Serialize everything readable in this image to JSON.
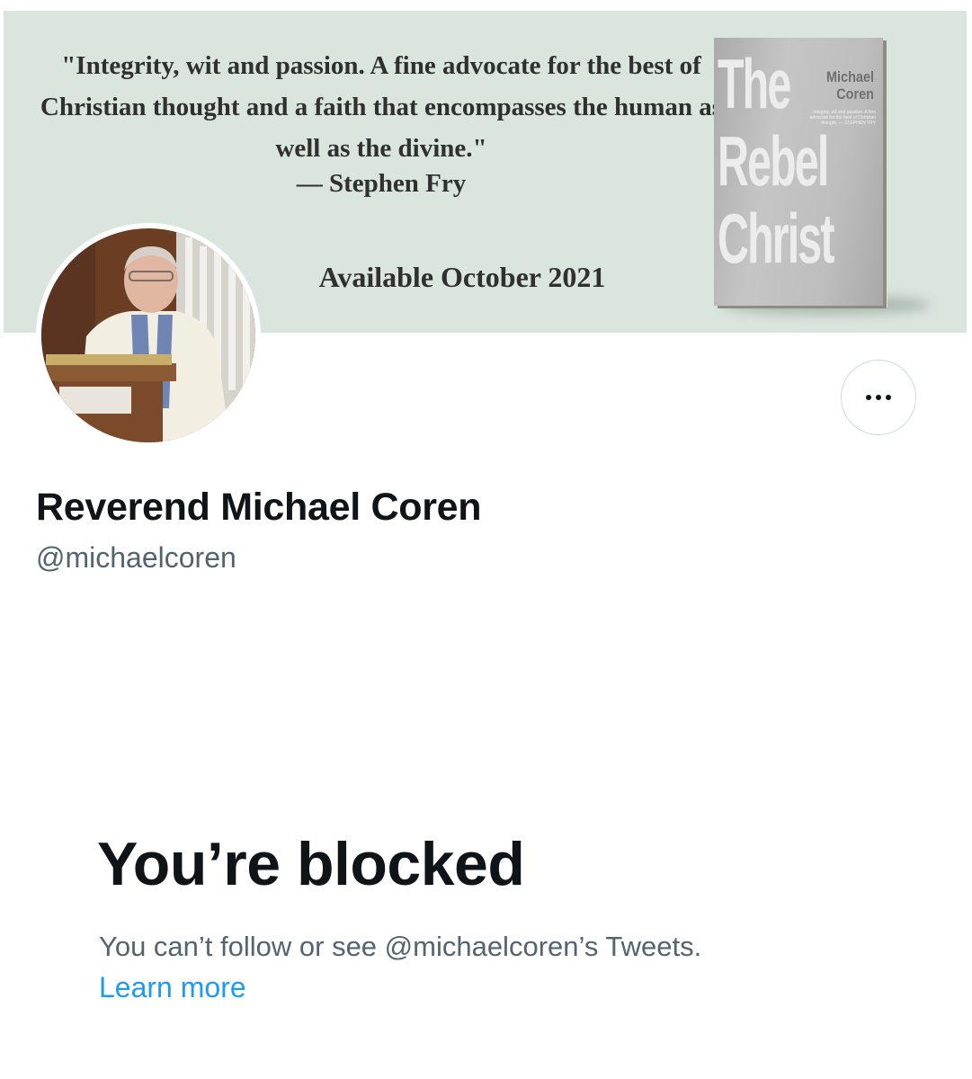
{
  "banner": {
    "quote": "\"Integrity, wit and passion. A fine advocate for the best of Christian thought and a faith that encompasses the human as well as the divine.\"",
    "attribution": "— Stephen Fry",
    "availability": "Available October 2021",
    "book": {
      "title": "The\nRebel\nChrist",
      "author": "Michael\nCoren",
      "blurb": "Integrity, wit and passion. A fine advocate for the best of Christian thought. — STEPHEN FRY"
    }
  },
  "profile": {
    "display_name": "Reverend Michael Coren",
    "handle": "@michaelcoren",
    "more_label": "More"
  },
  "blocked": {
    "title": "You’re blocked",
    "message": "You can’t follow or see @michaelcoren’s Tweets.",
    "learn_more": "Learn more"
  },
  "colors": {
    "banner_bg": "#d9e5dd",
    "primary_text": "#0f1419",
    "secondary_text": "#536471",
    "link": "#1d9bf0"
  }
}
